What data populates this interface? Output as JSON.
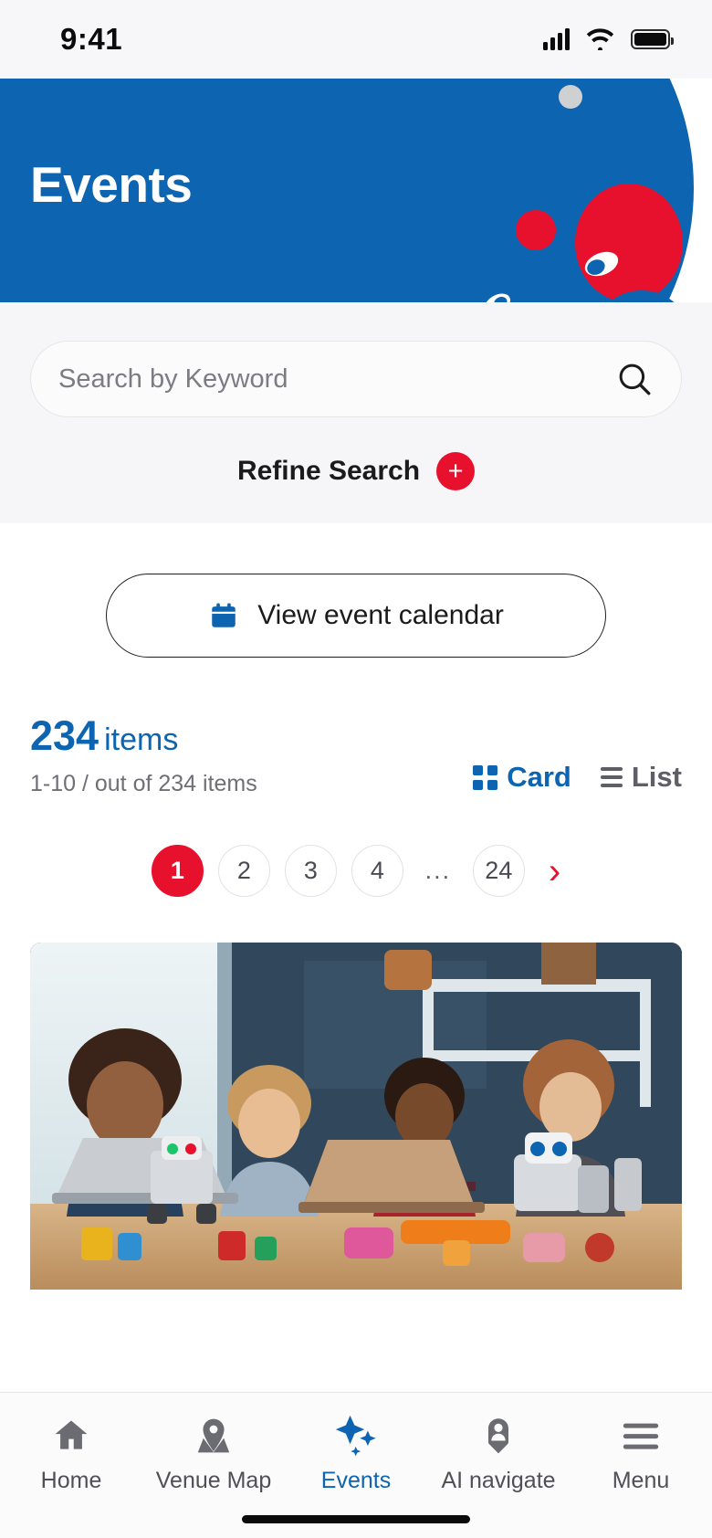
{
  "statusbar": {
    "time": "9:41",
    "signal_icon": "cellular-signal-icon",
    "wifi_icon": "wifi-icon",
    "battery_icon": "battery-icon"
  },
  "hero": {
    "title": "Events",
    "background_color": "#0d64b0",
    "accent_red": "#e8112d",
    "accent_gray": "#cccdd0"
  },
  "search": {
    "placeholder": "Search by Keyword",
    "value": "",
    "search_icon": "search-icon",
    "refine_label": "Refine Search",
    "refine_plus": "+"
  },
  "calendar_button": {
    "label": "View event calendar",
    "icon": "calendar-icon"
  },
  "results": {
    "count": "234",
    "count_word": "items",
    "range_text": "1-10 / out of 234 items",
    "accent_color": "#0d64b0"
  },
  "view_toggle": {
    "card_label": "Card",
    "list_label": "List",
    "active": "Card"
  },
  "pagination": {
    "pages": [
      "1",
      "2",
      "3",
      "4",
      "...",
      "24"
    ],
    "current": "1",
    "next_glyph": "›",
    "active_color": "#e8112d"
  },
  "bottom_nav": {
    "items": [
      {
        "label": "Home",
        "icon": "home-icon",
        "active": false
      },
      {
        "label": "Venue Map",
        "icon": "map-pin-icon",
        "active": false
      },
      {
        "label": "Events",
        "icon": "stars-icon",
        "active": true
      },
      {
        "label": "AI navigate",
        "icon": "person-pin-icon",
        "active": false
      },
      {
        "label": "Menu",
        "icon": "hamburger-menu-icon",
        "active": false
      }
    ]
  }
}
